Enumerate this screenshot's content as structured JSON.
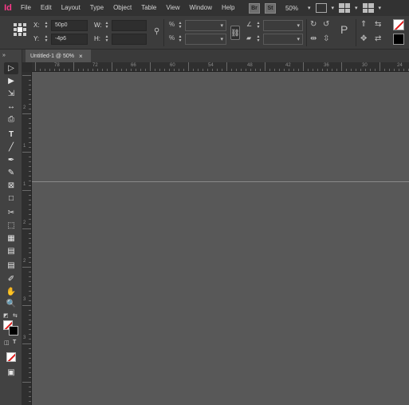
{
  "app": {
    "logo_text": "Id",
    "accent": "#ff3a8a"
  },
  "menu": {
    "items": [
      "File",
      "Edit",
      "Layout",
      "Type",
      "Object",
      "Table",
      "View",
      "Window",
      "Help"
    ],
    "bridge_label": "Br",
    "stock_label": "St",
    "zoom": "50%"
  },
  "control": {
    "x_label": "X:",
    "x_value": "50p0",
    "y_label": "Y:",
    "y_value": "-4p6",
    "w_label": "W:",
    "h_label": "H:",
    "chain_icon": "chain-link-icon",
    "stroke_color": "#000000",
    "fill_color": "none"
  },
  "document": {
    "tab_title": "Untitled-1 @ 50%",
    "close_glyph": "×"
  },
  "rulers": {
    "horizontal": [
      "78",
      "72",
      "66",
      "60",
      "54",
      "48",
      "42",
      "36",
      "30",
      "24"
    ],
    "vertical": [
      "2",
      "1",
      "1",
      "2",
      "2",
      "3",
      "3"
    ]
  },
  "colors": {
    "menubar": "#323232",
    "panel": "#3c3c3c",
    "canvas": "#585858",
    "none_swatch_slash": "#e01b1b"
  }
}
